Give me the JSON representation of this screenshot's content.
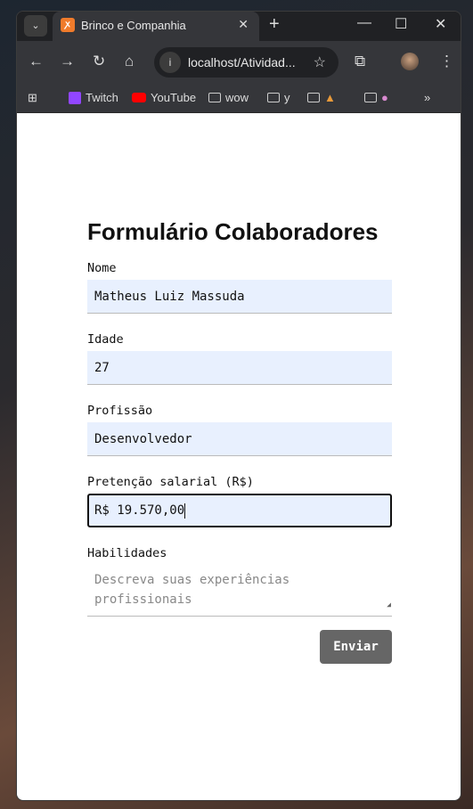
{
  "browser": {
    "tab_title": "Brinco e Companhia",
    "url": "localhost/Atividad...",
    "bookmarks": [
      "Twitch",
      "YouTube",
      "wow",
      "y"
    ]
  },
  "form": {
    "title": "Formulário Colaboradores",
    "fields": [
      {
        "label": "Nome",
        "value": "Matheus Luiz Massuda"
      },
      {
        "label": "Idade",
        "value": "27"
      },
      {
        "label": "Profissão",
        "value": "Desenvolvedor"
      },
      {
        "label": "Pretenção salarial (R$)",
        "value": "R$ 19.570,00"
      }
    ],
    "skills_label": "Habilidades",
    "skills_placeholder": "Descreva suas experiências profissionais",
    "submit_label": "Enviar"
  }
}
